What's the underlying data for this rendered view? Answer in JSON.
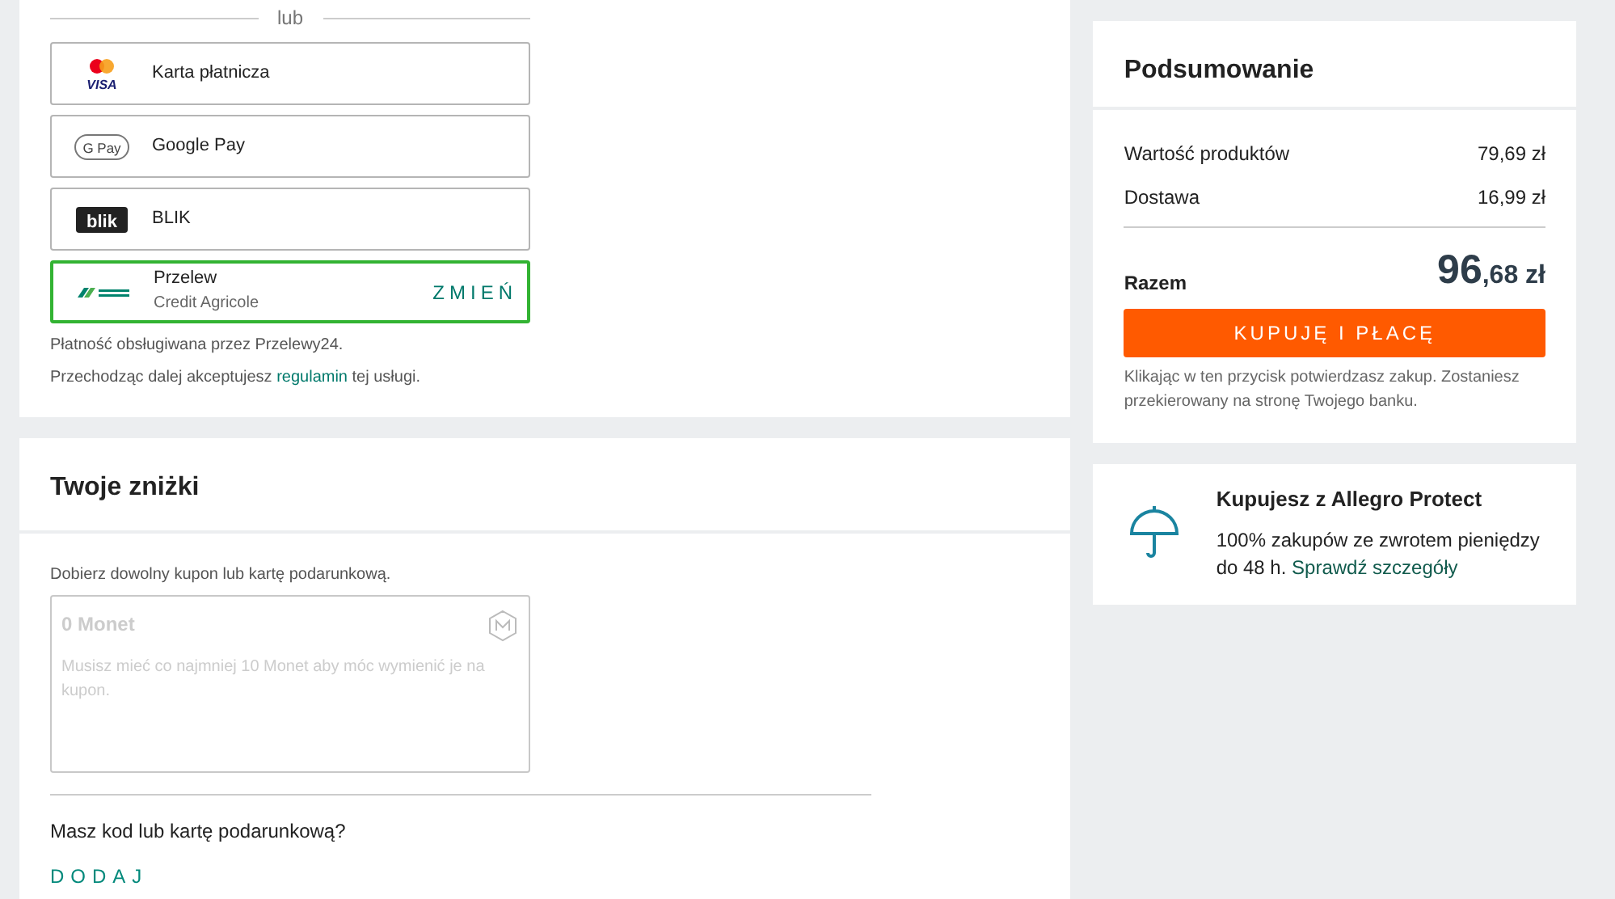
{
  "payment": {
    "divider_label": "lub",
    "methods": [
      {
        "kind": "card",
        "logo_text": "VISA",
        "label": "Karta płatnicza",
        "selected": false
      },
      {
        "kind": "gpay",
        "logo_text": "G Pay",
        "label": "Google Pay",
        "selected": false
      },
      {
        "kind": "blik",
        "logo_text": "blik",
        "label": "BLIK",
        "selected": false
      },
      {
        "kind": "bank",
        "label": "Przelew",
        "sublabel": "Credit Agricole",
        "action": "ZMIEŃ",
        "selected": true
      }
    ],
    "provider_note": "Płatność obsługiwana przez Przelewy24.",
    "terms": {
      "before": "Przechodząc dalej akceptujesz",
      "link": "regulamin",
      "after": "tej usługi."
    }
  },
  "discounts": {
    "title": "Twoje zniżki",
    "hint": "Dobierz dowolny kupon lub kartę podarunkową.",
    "coins": {
      "title": "0 Monet",
      "text": "Musisz mieć co najmniej 10 Monet aby móc wymienić je na kupon.",
      "disabled": true
    },
    "code_question": "Masz kod lub kartę podarunkową?",
    "add_button": "DODAJ"
  },
  "summary": {
    "title": "Podsumowanie",
    "lines": [
      {
        "label": "Wartość produktów",
        "value": "79,69 zł"
      },
      {
        "label": "Dostawa",
        "value": "16,99 zł"
      }
    ],
    "total_label": "Razem",
    "total_main": "96",
    "total_rest": ",68 zł",
    "buy_button": "KUPUJĘ I PŁACĘ",
    "note": "Klikając w ten przycisk potwierdzasz zakup. Zostaniesz przekierowany na stronę Twojego banku."
  },
  "protect": {
    "title": "Kupujesz z Allegro Protect",
    "text": "100% zakupów ze zwrotem pieniędzy do 48 h.",
    "link": "Sprawdź szczegóły"
  }
}
